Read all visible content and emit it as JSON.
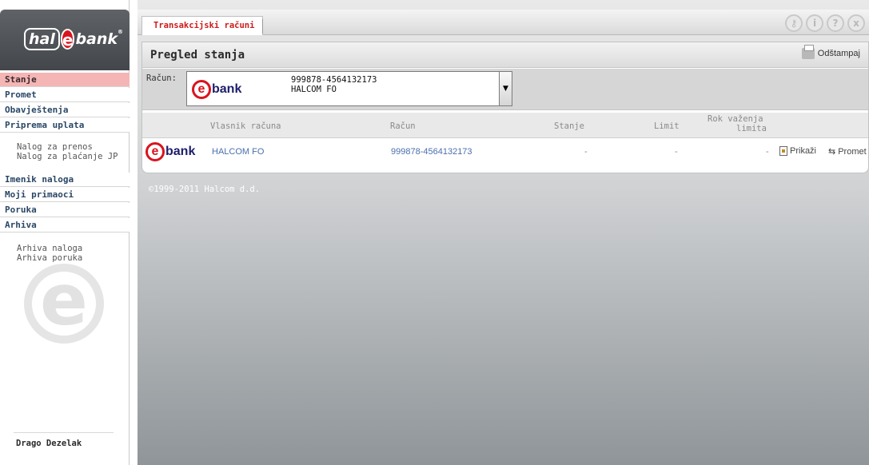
{
  "brand": {
    "hal": "hal",
    "e": "e",
    "bank": "bank",
    "reg": "®"
  },
  "sidebar": {
    "items": [
      {
        "label": "Stanje",
        "active": true
      },
      {
        "label": "Promet"
      },
      {
        "label": "Obavještenja"
      },
      {
        "label": "Priprema uplata"
      }
    ],
    "priprema_sub": [
      "Nalog za prenos",
      "Nalog za plaćanje JP"
    ],
    "items2": [
      {
        "label": "Imenik naloga"
      },
      {
        "label": "Moji primaoci"
      },
      {
        "label": "Poruka"
      },
      {
        "label": "Arhiva"
      }
    ],
    "arhiva_sub": [
      "Arhiva naloga",
      "Arhiva poruka"
    ],
    "user": "Drago Dezelak"
  },
  "topbar": {
    "tab": "Transakcijski računi",
    "icons": [
      "key-icon",
      "info-icon",
      "help-icon",
      "close-icon"
    ],
    "icon_glyphs": [
      "⚷",
      "i",
      "?",
      "x"
    ]
  },
  "panel": {
    "title": "Pregled stanja",
    "print_label": "Odštampaj",
    "account_label": "Račun:",
    "selected_account": {
      "number": "999878-4564132173",
      "owner": "HALCOM FO"
    },
    "ebank_e": "e",
    "ebank_bank": "bank",
    "columns": [
      "Vlasnik računa",
      "Račun",
      "Stanje",
      "Limit",
      "Rok važenja",
      "limita"
    ],
    "row": {
      "owner": "HALCOM FO",
      "account": "999878-4564132173",
      "balance": "-",
      "limit": "-",
      "expiry": "-",
      "show": "Prikaži",
      "promet": "Promet"
    }
  },
  "footer": {
    "copyright": "©1999-2011 Halcom d.d."
  },
  "colors": {
    "accent": "#cc1b1b",
    "active_nav": "#f5b5b5",
    "link": "#4a6fae"
  }
}
